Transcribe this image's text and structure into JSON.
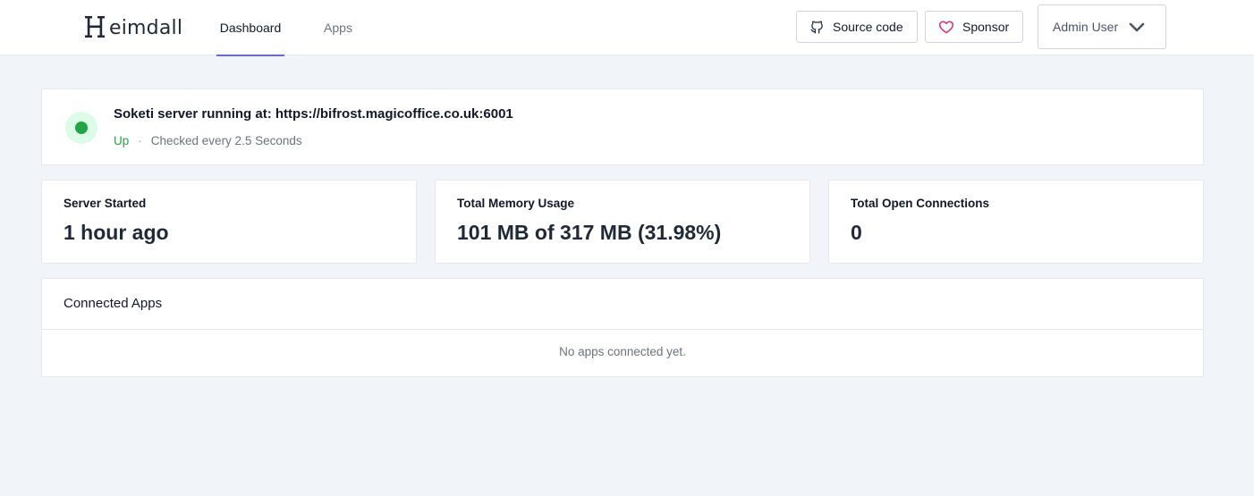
{
  "brand": {
    "name": "eimdall",
    "initial": "H"
  },
  "nav": {
    "tabs": [
      {
        "label": "Dashboard",
        "active": true
      },
      {
        "label": "Apps",
        "active": false
      }
    ]
  },
  "toolbar": {
    "source_label": "Source code",
    "sponsor_label": "Sponsor",
    "user_name": "Admin User"
  },
  "status": {
    "title": "Soketi server running at: https://bifrost.magicoffice.co.uk:6001",
    "state": "Up",
    "separator": "·",
    "interval": "Checked every 2.5 Seconds",
    "color": "#22a447"
  },
  "stats": [
    {
      "label": "Server Started",
      "value": "1 hour ago"
    },
    {
      "label": "Total Memory Usage",
      "value": "101 MB of 317 MB (31.98%)"
    },
    {
      "label": "Total Open Connections",
      "value": "0"
    }
  ],
  "apps_panel": {
    "title": "Connected Apps",
    "empty_text": "No apps connected yet."
  },
  "colors": {
    "accent": "#6366f1",
    "sponsor_heart": "#db2777",
    "background": "#f1f4f8"
  }
}
